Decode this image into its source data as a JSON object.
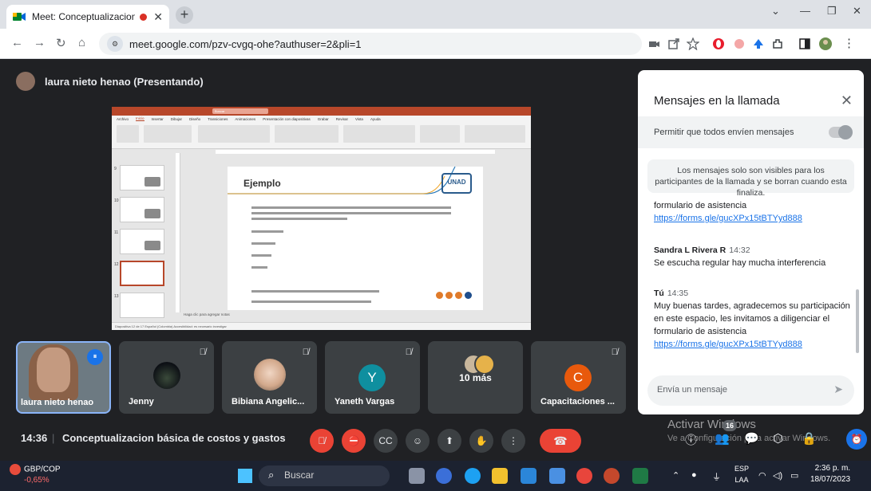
{
  "browser": {
    "tab_title": "Meet: Conceptualizacion b",
    "url": "meet.google.com/pzv-cvgq-ohe?authuser=2&pli=1"
  },
  "meet": {
    "presenter_label": "laura nieto henao (Presentando)",
    "meeting_time": "14:36",
    "meeting_separator": "|",
    "meeting_title": "Conceptualizacion básica de costos y gastos",
    "participant_count": "16"
  },
  "shared_screen": {
    "app": "PowerPoint",
    "slide_title": "Ejemplo",
    "slide_logo": "UNAD",
    "menu": [
      "Archivo",
      "Inicio",
      "Insertar",
      "Dibujar",
      "Diseño",
      "Transiciones",
      "Animaciones",
      "Presentación con diapositivas",
      "Grabar",
      "Revisar",
      "Vista",
      "Ayuda"
    ],
    "search": "Buscar",
    "notes": "Haga clic para agregar notas",
    "status": "Diapositiva 12 de 17   Español (Colombia)   Accesibilidad: es necesario investigar"
  },
  "participants": [
    {
      "name": "laura nieto henao",
      "kind": "self"
    },
    {
      "name": "Jenny",
      "kind": "image"
    },
    {
      "name": "Bibiana Angelic...",
      "kind": "image"
    },
    {
      "name": "Yaneth Vargas",
      "initial": "Y",
      "color": "#0f8f9f"
    },
    {
      "name": "10 más",
      "kind": "more"
    },
    {
      "name": "Capacitaciones ...",
      "initial": "C",
      "color": "#e8590c"
    }
  ],
  "chat": {
    "header": "Mensajes en la llamada",
    "allow_label": "Permitir que todos envíen mensajes",
    "notice": "Los mensajes solo son visibles para los participantes de la llamada y se borran cuando esta finaliza.",
    "messages": [
      {
        "text": "formulario de asistencia",
        "link": "https://forms.gle/gucXPx15tBTYyd888"
      },
      {
        "author": "Sandra L Rivera R",
        "time": "14:32",
        "text": "Se escucha regular hay mucha interferencia"
      },
      {
        "author": "Tú",
        "time": "14:35",
        "text": "Muy buenas tardes, agradecemos su participación en este espacio, les invitamos a diligenciar el formulario de asistencia",
        "link": "https://forms.gle/gucXPx15tBTYyd888"
      }
    ],
    "input_placeholder": "Envía un mensaje"
  },
  "windows": {
    "watermark_title": "Activar Windows",
    "watermark_sub": "Ve a Configuración para activar Windows."
  },
  "taskbar": {
    "fx_pair": "GBP/COP",
    "fx_change": "-0,65%",
    "search_placeholder": "Buscar",
    "lang_top": "ESP",
    "lang_bottom": "LAA",
    "time": "2:36 p. m.",
    "date": "18/07/2023"
  },
  "colors": {
    "meet_bg": "#202124",
    "end_call": "#ea4335",
    "accent": "#1a73e8",
    "powerpoint": "#b7472a"
  }
}
